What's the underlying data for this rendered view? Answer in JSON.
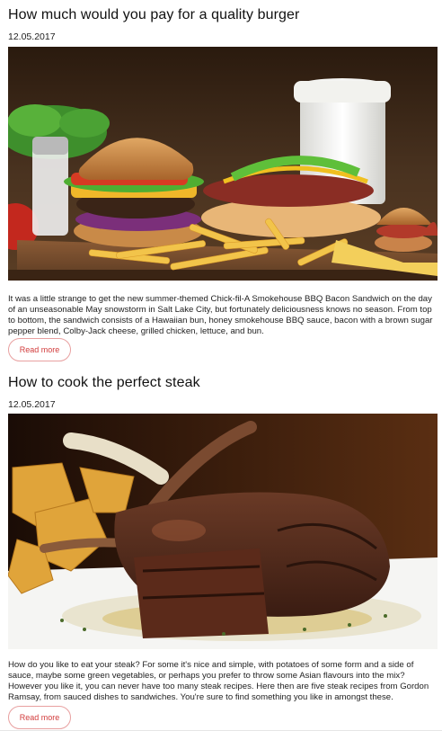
{
  "articles": [
    {
      "title": "How much would you pay for a quality burger",
      "date": "12.05.2017",
      "body": "It was a little strange to get the new summer-themed Chick-fil-A Smokehouse BBQ Bacon Sandwich on the day of an unseasonable May snowstorm in Salt Lake City, but fortunately deliciousness knows no season. From top to bottom, the sandwich consists of a Hawaiian bun, honey smokehouse BBQ sauce, bacon with a brown sugar pepper blend, Colby-Jack cheese, grilled chicken, lettuce, and bun.",
      "button_label": "Read more",
      "image": "burger-fries-hotdog-photo"
    },
    {
      "title": "How to cook the perfect steak",
      "date": "12.05.2017",
      "body": "How do you like to eat your steak? For some it's nice and simple, with potatoes of some form and a side of sauce, maybe some green vegetables, or perhaps you prefer to throw some Asian flavours into the mix? However you like it, you can never have too many steak recipes. Here then are five steak recipes from Gordon Ramsay, from sauced dishes to sandwiches. You're sure to find something you like in amongst these.",
      "button_label": "Read more",
      "image": "lamb-chops-potatoes-photo"
    }
  ],
  "colors": {
    "accent": "#d23c3c",
    "button_border": "#e8a0a0"
  }
}
